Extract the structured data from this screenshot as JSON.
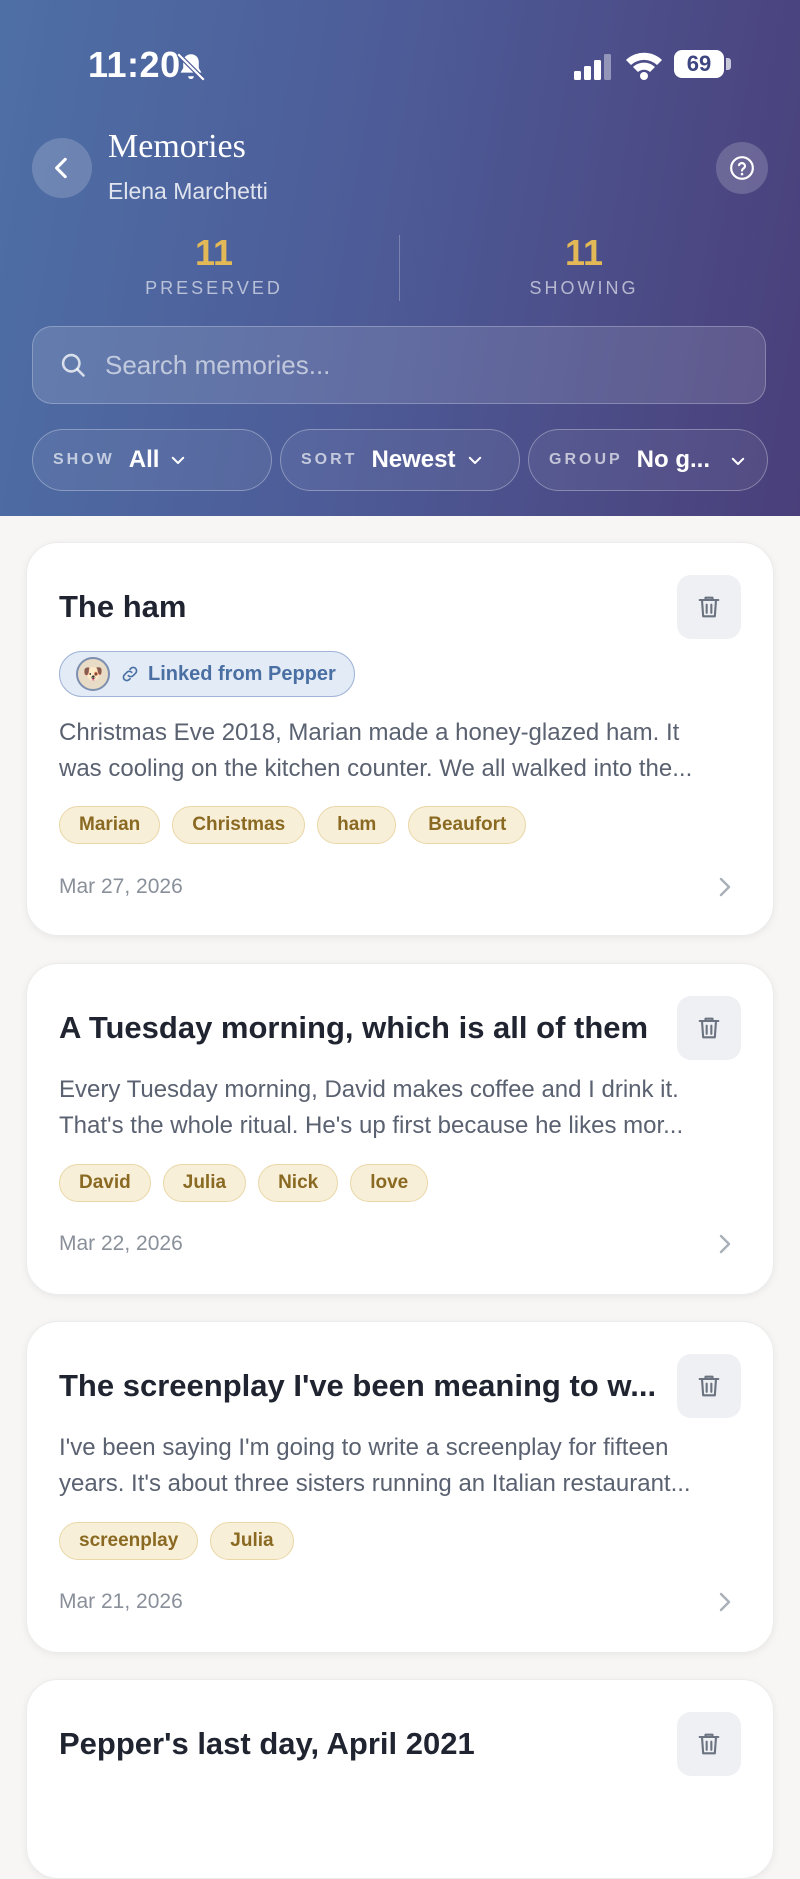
{
  "status": {
    "time": "11:20",
    "battery": "69"
  },
  "header": {
    "title": "Memories",
    "subtitle": "Elena Marchetti",
    "stats": [
      {
        "value": "11",
        "label": "PRESERVED"
      },
      {
        "value": "11",
        "label": "SHOWING"
      }
    ],
    "search_placeholder": "Search memories...",
    "filters": [
      {
        "label": "SHOW",
        "value": "All"
      },
      {
        "label": "SORT",
        "value": "Newest"
      },
      {
        "label": "GROUP",
        "value": "No g..."
      }
    ]
  },
  "memories": [
    {
      "title": "The ham",
      "linked": "Linked from Pepper",
      "excerpt": [
        "Christmas Eve 2018, Marian made a honey-glazed ham. It",
        "was cooling on the kitchen counter. We all walked into the..."
      ],
      "tags": [
        "Marian",
        "Christmas",
        "ham",
        "Beaufort"
      ],
      "date": "Mar 27, 2026"
    },
    {
      "title": "A Tuesday morning, which is all of them",
      "excerpt": [
        "Every Tuesday morning, David makes coffee and I drink it.",
        "That's the whole ritual. He's up first because he likes mor..."
      ],
      "tags": [
        "David",
        "Julia",
        "Nick",
        "love"
      ],
      "date": "Mar 22, 2026"
    },
    {
      "title": "The screenplay I've been meaning to w...",
      "excerpt": [
        "I've been saying I'm going to write a screenplay for fifteen",
        "years. It's about three sisters running an Italian restaurant..."
      ],
      "tags": [
        "screenplay",
        "Julia"
      ],
      "date": "Mar 21, 2026"
    },
    {
      "title": "Pepper's last day, April 2021"
    }
  ],
  "colors": {
    "accent_gold": "#e3b857",
    "header_start": "#4e6fa6",
    "header_end": "#4a3f7a",
    "tag_bg": "#f8efd8",
    "tag_text": "#8a6a22"
  }
}
